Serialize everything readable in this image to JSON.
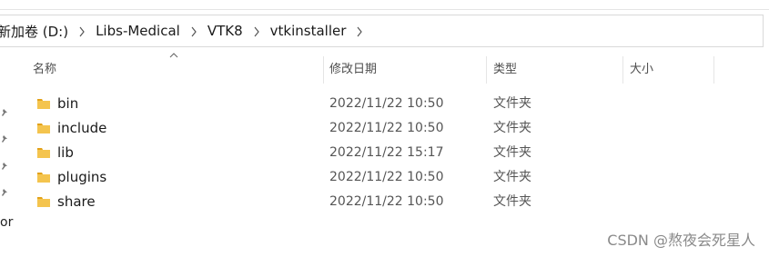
{
  "breadcrumbs": [
    {
      "label": "新加卷 (D:)"
    },
    {
      "label": "Libs-Medical"
    },
    {
      "label": "VTK8"
    },
    {
      "label": "vtkinstaller"
    }
  ],
  "columns": {
    "name": "名称",
    "date": "修改日期",
    "type": "类型",
    "size": "大小"
  },
  "files": [
    {
      "name": "bin",
      "date": "2022/11/22 10:50",
      "type": "文件夹",
      "size": ""
    },
    {
      "name": "include",
      "date": "2022/11/22 10:50",
      "type": "文件夹",
      "size": ""
    },
    {
      "name": "lib",
      "date": "2022/11/22 15:17",
      "type": "文件夹",
      "size": ""
    },
    {
      "name": "plugins",
      "date": "2022/11/22 10:50",
      "type": "文件夹",
      "size": ""
    },
    {
      "name": "share",
      "date": "2022/11/22 10:50",
      "type": "文件夹",
      "size": ""
    }
  ],
  "sidebar_fragment": "or",
  "watermark": "CSDN @熬夜会死星人",
  "icons": {
    "folder": "folder-icon",
    "pin": "pin-icon",
    "separator": "chevron-right-icon",
    "sort": "sort-up-icon"
  },
  "colors": {
    "folder_fill": "#f4c44e",
    "folder_tab": "#e3a21a",
    "border": "#d9d9d9"
  }
}
